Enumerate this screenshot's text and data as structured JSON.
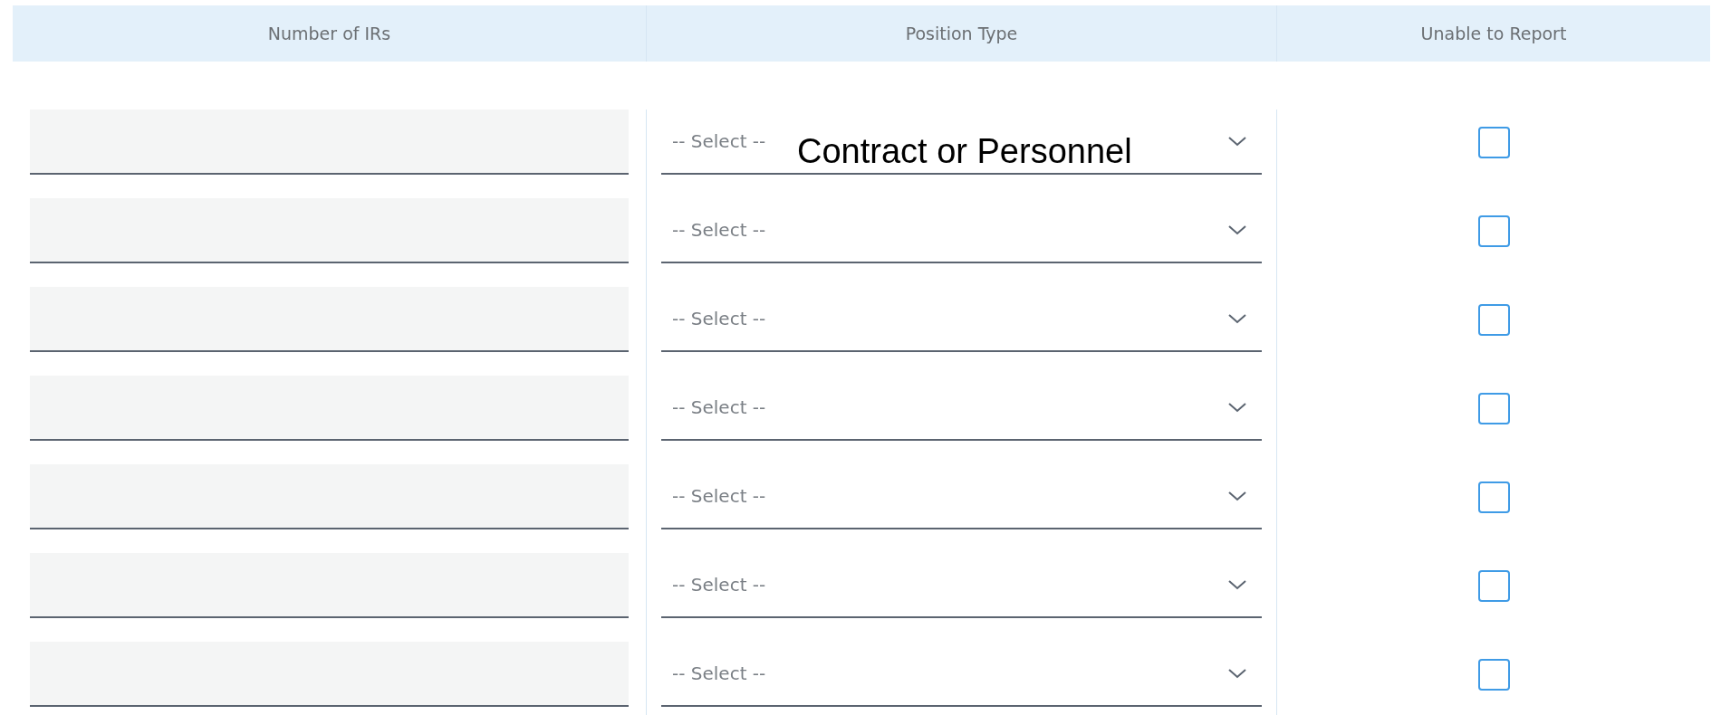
{
  "table": {
    "columns": [
      "Number of IRs",
      "Position Type",
      "Unable to Report"
    ],
    "rows": [
      {
        "number_of_irs": "",
        "position_type": "-- Select --",
        "annotation": "Contract or Personnel",
        "unable_to_report": false
      },
      {
        "number_of_irs": "",
        "position_type": "-- Select --",
        "unable_to_report": false
      },
      {
        "number_of_irs": "",
        "position_type": "-- Select --",
        "unable_to_report": false
      },
      {
        "number_of_irs": "",
        "position_type": "-- Select --",
        "unable_to_report": false
      },
      {
        "number_of_irs": "",
        "position_type": "-- Select --",
        "unable_to_report": false
      },
      {
        "number_of_irs": "",
        "position_type": "-- Select --",
        "unable_to_report": false
      },
      {
        "number_of_irs": "",
        "position_type": "-- Select --",
        "unable_to_report": false
      }
    ]
  }
}
